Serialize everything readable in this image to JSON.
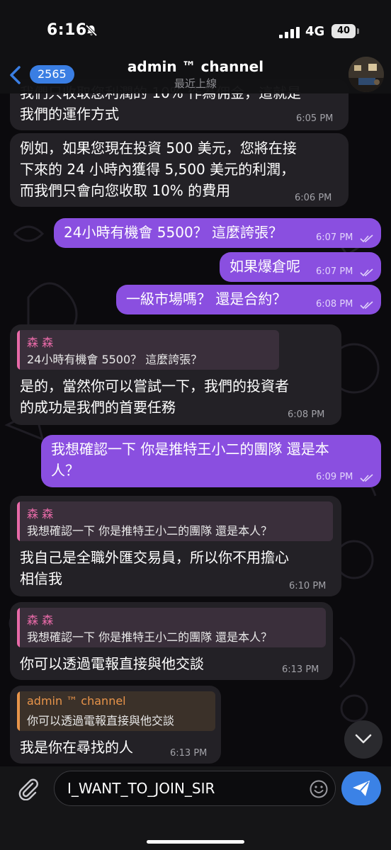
{
  "status_bar": {
    "time": "6:16",
    "network": "4G",
    "battery": "40"
  },
  "header": {
    "back_count": "2565",
    "title": "admin ™ channel",
    "subtitle": "最近上線"
  },
  "messages": [
    {
      "lines": [
        "我們只收取您利潤的 10% 作為佣金，這就是",
        "我們的運作方式"
      ],
      "time": "6:05 PM"
    },
    {
      "lines": [
        "例如，如果您現在投資 500 美元，您將在接",
        "下來的 24 小時內獲得 5,500 美元的利潤，",
        "而我們只會向您收取 10% 的費用"
      ],
      "time": "6:06 PM"
    },
    {
      "lines": [
        "24小時有機會 5500？ 這麼誇張？"
      ],
      "time": "6:07 PM"
    },
    {
      "lines": [
        "如果爆倉呢"
      ],
      "time": "6:07 PM"
    },
    {
      "lines": [
        "一級市場嗎？ 還是合約？"
      ],
      "time": "6:08 PM"
    },
    {
      "reply_name": "森 森",
      "reply_text": "24小時有機會 5500？ 這麼誇張？",
      "lines": [
        "是的，當然你可以嘗試一下，我們的投資者",
        "的成功是我們的首要任務"
      ],
      "time": "6:08 PM"
    },
    {
      "lines": [
        "我想確認一下 你是推特王小二的團隊 還是本",
        "人？"
      ],
      "time": "6:09 PM"
    },
    {
      "reply_name": "森 森",
      "reply_text": "我想確認一下 你是推特王小二的團隊 還是本人？",
      "lines": [
        "我自己是全職外匯交易員，所以你不用擔心",
        "相信我"
      ],
      "time": "6:10 PM"
    },
    {
      "reply_name": "森 森",
      "reply_text": "我想確認一下 你是推特王小二的團隊 還是本人？",
      "lines": [
        "你可以透過電報直接與他交談"
      ],
      "time": "6:13 PM"
    },
    {
      "reply_name": "admin ™ channel",
      "reply_text": "你可以透過電報直接與他交談",
      "lines": [
        "我是你在尋找的人"
      ],
      "time": "6:13 PM"
    }
  ],
  "input": {
    "value": "I_WANT_TO_JOIN_SIR"
  },
  "colors": {
    "outgoing_bubble": "#8a4fe0",
    "incoming_bubble": "#232126",
    "reply_name_pink": "#e86aa8",
    "reply_name_orange": "#e8944a",
    "accent_blue": "#3b82e6"
  },
  "icons": [
    "bell-slash-icon",
    "signal-icon",
    "back-chevron-icon",
    "double-check-icon",
    "chevron-down-icon",
    "paperclip-icon",
    "emoji-icon",
    "send-icon"
  ]
}
